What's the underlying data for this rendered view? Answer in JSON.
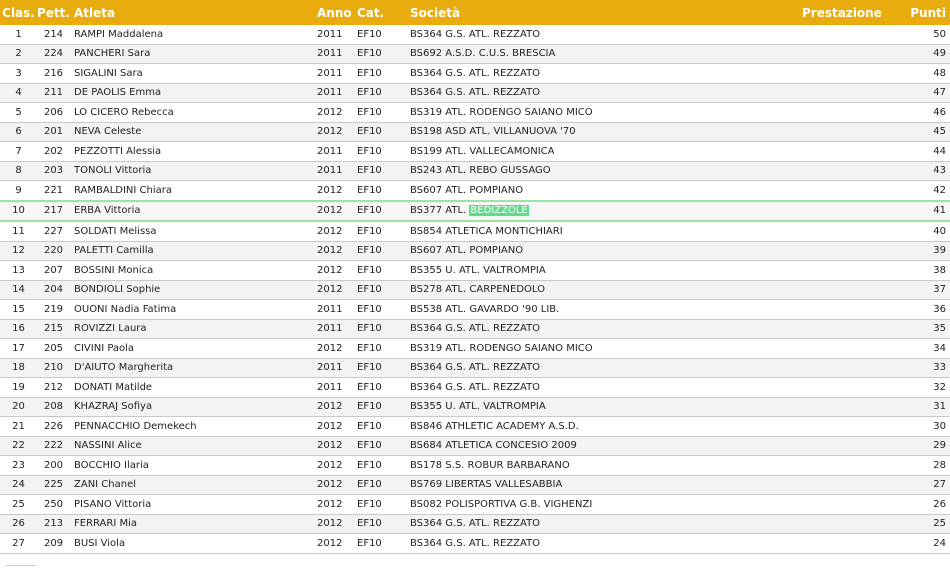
{
  "headers": {
    "clas": "Clas.",
    "pett": "Pett.",
    "atleta": "Atleta",
    "anno": "Anno",
    "cat": "Cat.",
    "societa": "Società",
    "prestazione": "Prestazione",
    "punti": "Punti"
  },
  "highlight": {
    "row_index": 9,
    "word": "BEDIZZOLE",
    "color": "#5fdc8a"
  },
  "rows": [
    {
      "clas": "1",
      "pett": "214",
      "atleta": "RAMPI Maddalena",
      "anno": "2011",
      "cat": "EF10",
      "societa": "BS364 G.S. ATL. REZZATO",
      "prestazione": "",
      "punti": "50"
    },
    {
      "clas": "2",
      "pett": "224",
      "atleta": "PANCHERI Sara",
      "anno": "2011",
      "cat": "EF10",
      "societa": "BS692 A.S.D. C.U.S. BRESCIA",
      "prestazione": "",
      "punti": "49"
    },
    {
      "clas": "3",
      "pett": "216",
      "atleta": "SIGALINI Sara",
      "anno": "2011",
      "cat": "EF10",
      "societa": "BS364 G.S. ATL. REZZATO",
      "prestazione": "",
      "punti": "48"
    },
    {
      "clas": "4",
      "pett": "211",
      "atleta": "DE PAOLIS Emma",
      "anno": "2011",
      "cat": "EF10",
      "societa": "BS364 G.S. ATL. REZZATO",
      "prestazione": "",
      "punti": "47"
    },
    {
      "clas": "5",
      "pett": "206",
      "atleta": "LO CICERO Rebecca",
      "anno": "2012",
      "cat": "EF10",
      "societa": "BS319 ATL. RODENGO SAIANO MICO",
      "prestazione": "",
      "punti": "46"
    },
    {
      "clas": "6",
      "pett": "201",
      "atleta": "NEVA Celeste",
      "anno": "2012",
      "cat": "EF10",
      "societa": "BS198 ASD ATL. VILLANUOVA '70",
      "prestazione": "",
      "punti": "45"
    },
    {
      "clas": "7",
      "pett": "202",
      "atleta": "PEZZOTTI Alessia",
      "anno": "2011",
      "cat": "EF10",
      "societa": "BS199 ATL. VALLECAMONICA",
      "prestazione": "",
      "punti": "44"
    },
    {
      "clas": "8",
      "pett": "203",
      "atleta": "TONOLI Vittoria",
      "anno": "2011",
      "cat": "EF10",
      "societa": "BS243 ATL. REBO GUSSAGO",
      "prestazione": "",
      "punti": "43"
    },
    {
      "clas": "9",
      "pett": "221",
      "atleta": "RAMBALDINI Chiara",
      "anno": "2012",
      "cat": "EF10",
      "societa": "BS607 ATL. POMPIANO",
      "prestazione": "",
      "punti": "42"
    },
    {
      "clas": "10",
      "pett": "217",
      "atleta": "ERBA Vittoria",
      "anno": "2012",
      "cat": "EF10",
      "societa": "BS377 ATL.",
      "prestazione": "",
      "punti": "41"
    },
    {
      "clas": "11",
      "pett": "227",
      "atleta": "SOLDATI Melissa",
      "anno": "2012",
      "cat": "EF10",
      "societa": "BS854 ATLETICA MONTICHIARI",
      "prestazione": "",
      "punti": "40"
    },
    {
      "clas": "12",
      "pett": "220",
      "atleta": "PALETTI Camilla",
      "anno": "2012",
      "cat": "EF10",
      "societa": "BS607 ATL. POMPIANO",
      "prestazione": "",
      "punti": "39"
    },
    {
      "clas": "13",
      "pett": "207",
      "atleta": "BOSSINI Monica",
      "anno": "2012",
      "cat": "EF10",
      "societa": "BS355 U. ATL. VALTROMPIA",
      "prestazione": "",
      "punti": "38"
    },
    {
      "clas": "14",
      "pett": "204",
      "atleta": "BONDIOLI Sophie",
      "anno": "2012",
      "cat": "EF10",
      "societa": "BS278 ATL. CARPENEDOLO",
      "prestazione": "",
      "punti": "37"
    },
    {
      "clas": "15",
      "pett": "219",
      "atleta": "OUONI Nadia Fatima",
      "anno": "2011",
      "cat": "EF10",
      "societa": "BS538 ATL. GAVARDO '90 LIB.",
      "prestazione": "",
      "punti": "36"
    },
    {
      "clas": "16",
      "pett": "215",
      "atleta": "ROVIZZI Laura",
      "anno": "2011",
      "cat": "EF10",
      "societa": "BS364 G.S. ATL. REZZATO",
      "prestazione": "",
      "punti": "35"
    },
    {
      "clas": "17",
      "pett": "205",
      "atleta": "CIVINI Paola",
      "anno": "2012",
      "cat": "EF10",
      "societa": "BS319 ATL. RODENGO SAIANO MICO",
      "prestazione": "",
      "punti": "34"
    },
    {
      "clas": "18",
      "pett": "210",
      "atleta": "D'AIUTO Margherita",
      "anno": "2011",
      "cat": "EF10",
      "societa": "BS364 G.S. ATL. REZZATO",
      "prestazione": "",
      "punti": "33"
    },
    {
      "clas": "19",
      "pett": "212",
      "atleta": "DONATI Matilde",
      "anno": "2011",
      "cat": "EF10",
      "societa": "BS364 G.S. ATL. REZZATO",
      "prestazione": "",
      "punti": "32"
    },
    {
      "clas": "20",
      "pett": "208",
      "atleta": "KHAZRAJ Sofiya",
      "anno": "2012",
      "cat": "EF10",
      "societa": "BS355 U. ATL. VALTROMPIA",
      "prestazione": "",
      "punti": "31"
    },
    {
      "clas": "21",
      "pett": "226",
      "atleta": "PENNACCHIO Demekech",
      "anno": "2012",
      "cat": "EF10",
      "societa": "BS846 ATHLETIC ACADEMY A.S.D.",
      "prestazione": "",
      "punti": "30"
    },
    {
      "clas": "22",
      "pett": "222",
      "atleta": "NASSINI Alice",
      "anno": "2012",
      "cat": "EF10",
      "societa": "BS684 ATLETICA CONCESIO 2009",
      "prestazione": "",
      "punti": "29"
    },
    {
      "clas": "23",
      "pett": "200",
      "atleta": "BOCCHIO Ilaria",
      "anno": "2012",
      "cat": "EF10",
      "societa": "BS178 S.S. ROBUR BARBARANO",
      "prestazione": "",
      "punti": "28"
    },
    {
      "clas": "24",
      "pett": "225",
      "atleta": "ZANI Chanel",
      "anno": "2012",
      "cat": "EF10",
      "societa": "BS769 LIBERTAS VALLESABBIA",
      "prestazione": "",
      "punti": "27"
    },
    {
      "clas": "25",
      "pett": "250",
      "atleta": "PISANO Vittoria",
      "anno": "2012",
      "cat": "EF10",
      "societa": "BS082 POLISPORTIVA G.B. VIGHENZI",
      "prestazione": "",
      "punti": "26"
    },
    {
      "clas": "26",
      "pett": "213",
      "atleta": "FERRARI Mia",
      "anno": "2012",
      "cat": "EF10",
      "societa": "BS364 G.S. ATL. REZZATO",
      "prestazione": "",
      "punti": "25"
    },
    {
      "clas": "27",
      "pett": "209",
      "atleta": "BUSI Viola",
      "anno": "2012",
      "cat": "EF10",
      "societa": "BS364 G.S. ATL. REZZATO",
      "prestazione": "",
      "punti": "24"
    }
  ]
}
